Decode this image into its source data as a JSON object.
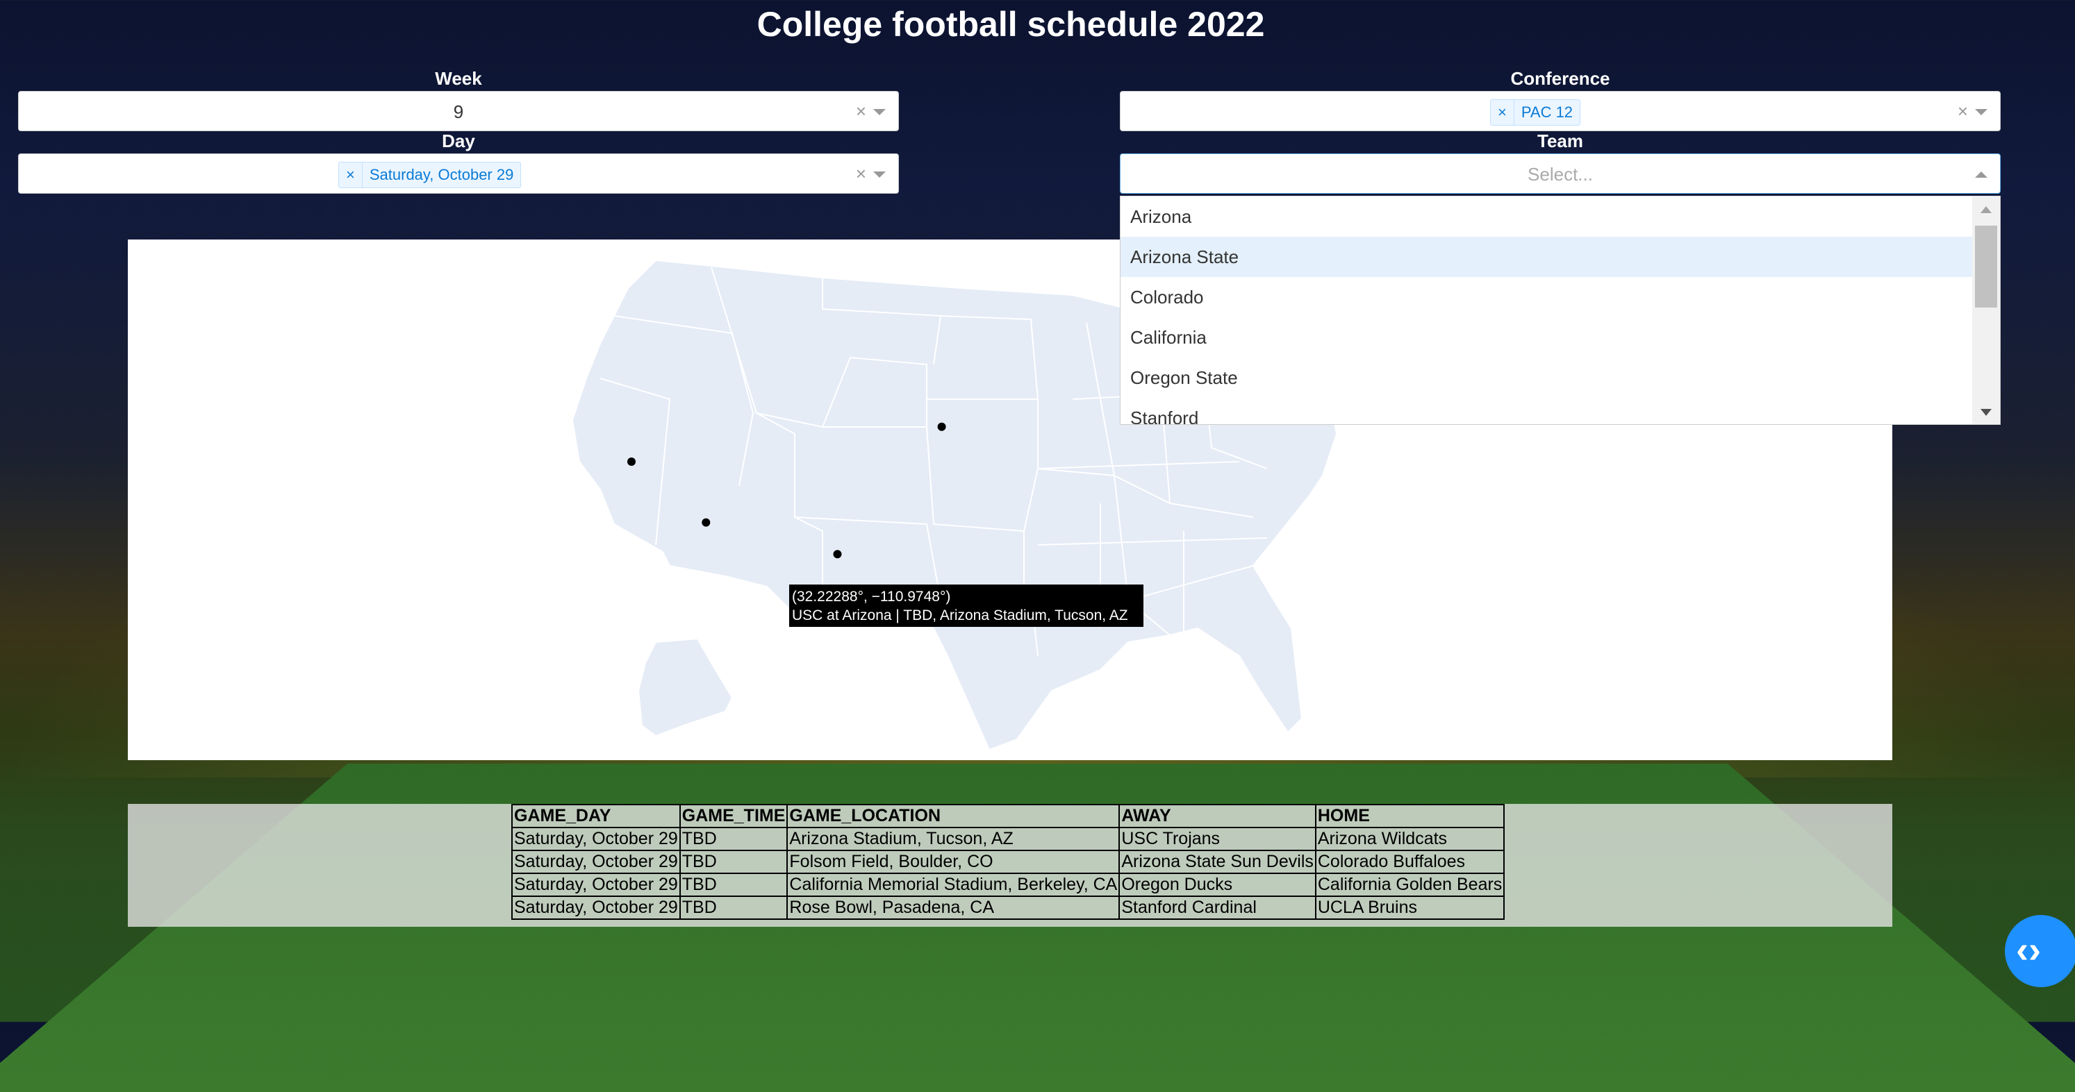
{
  "title": "College football schedule 2022",
  "filters": {
    "week": {
      "label": "Week",
      "value": "9"
    },
    "conference": {
      "label": "Conference",
      "tags": [
        "PAC 12"
      ]
    },
    "day": {
      "label": "Day",
      "tags": [
        "Saturday, October 29"
      ]
    },
    "team": {
      "label": "Team",
      "placeholder": "Select...",
      "options": [
        "Arizona",
        "Arizona State",
        "Colorado",
        "California",
        "Oregon State",
        "Stanford"
      ],
      "focused_option": "Arizona State"
    },
    "clear_symbol": "×",
    "tag_remove_symbol": "×"
  },
  "map": {
    "tooltip": {
      "coords": "(32.22288°, −110.9748°)",
      "text": "USC at Arizona | TBD, Arizona Stadium, Tucson, AZ"
    },
    "markers": [
      {
        "lat": 32.22288,
        "lon": -110.9748,
        "label": "Arizona Stadium, Tucson, AZ"
      },
      {
        "lat": 40.0,
        "lon": -105.27,
        "label": "Folsom Field, Boulder, CO"
      },
      {
        "lat": 37.87,
        "lon": -122.25,
        "label": "California Memorial Stadium, Berkeley, CA"
      },
      {
        "lat": 34.16,
        "lon": -118.17,
        "label": "Rose Bowl, Pasadena, CA"
      }
    ],
    "land_color": "#e5ecf6",
    "border_color": "#ffffff"
  },
  "table": {
    "columns": [
      "GAME_DAY",
      "GAME_TIME",
      "GAME_LOCATION",
      "AWAY",
      "HOME"
    ],
    "rows": [
      [
        "Saturday, October 29",
        "TBD",
        "Arizona Stadium, Tucson, AZ",
        "USC Trojans",
        "Arizona Wildcats"
      ],
      [
        "Saturday, October 29",
        "TBD",
        "Folsom Field, Boulder, CO",
        "Arizona State Sun Devils",
        "Colorado Buffaloes"
      ],
      [
        "Saturday, October 29",
        "TBD",
        "California Memorial Stadium, Berkeley, CA",
        "Oregon Ducks",
        "California Golden Bears"
      ],
      [
        "Saturday, October 29",
        "TBD",
        "Rose Bowl, Pasadena, CA",
        "Stanford Cardinal",
        "UCLA Bruins"
      ]
    ]
  },
  "fab": {
    "icon": "code-icon",
    "label": "‹›"
  },
  "accent_color": "#1e90ff"
}
